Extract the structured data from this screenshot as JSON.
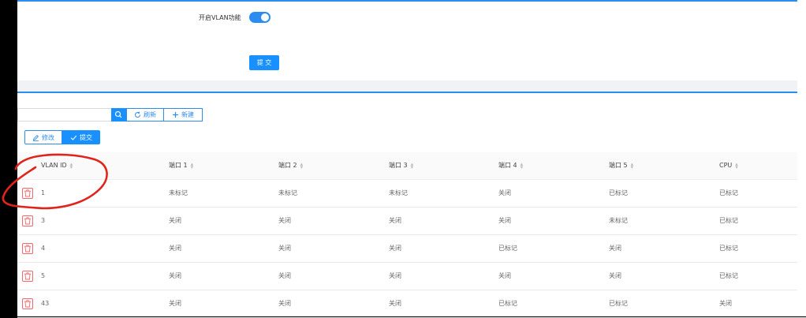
{
  "settings": {
    "vlan_label": "开启VLAN功能",
    "vlan_enabled": true,
    "submit_label": "提 交"
  },
  "toolbar": {
    "search_placeholder": "",
    "refresh_label": "刷新",
    "new_label": "新建",
    "edit_label": "修改",
    "submit_label": "提交"
  },
  "table": {
    "columns": [
      "VLAN ID",
      "端口 1",
      "端口 2",
      "端口 3",
      "端口 4",
      "端口 5",
      "CPU"
    ],
    "rows": [
      [
        "1",
        "未标记",
        "未标记",
        "未标记",
        "关闭",
        "已标记",
        "已标记"
      ],
      [
        "3",
        "关闭",
        "关闭",
        "关闭",
        "关闭",
        "未标记",
        "已标记"
      ],
      [
        "4",
        "关闭",
        "关闭",
        "关闭",
        "已标记",
        "关闭",
        "已标记"
      ],
      [
        "5",
        "关闭",
        "关闭",
        "关闭",
        "关闭",
        "关闭",
        "已标记"
      ],
      [
        "43",
        "关闭",
        "关闭",
        "关闭",
        "已标记",
        "已标记",
        "关闭"
      ]
    ]
  },
  "colors": {
    "accent": "#1890ff",
    "danger": "#f5666b",
    "annotation": "#e0241c"
  },
  "icons": {
    "search": "search-icon",
    "refresh": "refresh-icon",
    "add": "plus-icon",
    "edit": "edit-icon",
    "check": "check-icon",
    "delete": "trash-icon"
  }
}
